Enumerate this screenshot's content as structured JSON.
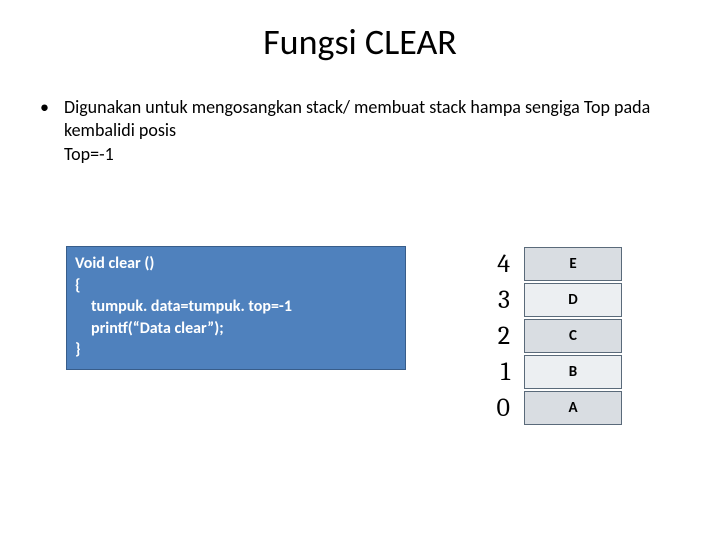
{
  "title": "Fungsi CLEAR",
  "bullet": {
    "marker": "•",
    "line1": "Digunakan untuk mengosangkan stack/ membuat stack hampa sengiga Top pada kembalidi posis",
    "line2": "Top=-1"
  },
  "code": {
    "l1": "Void clear ()",
    "l2": "{",
    "l3": "tumpuk. data=tumpuk. top=-1",
    "l4": "printf(“Data clear”);",
    "l5": "}"
  },
  "stack": [
    {
      "index": "4",
      "label": "E",
      "alt": false
    },
    {
      "index": "3",
      "label": "D",
      "alt": true
    },
    {
      "index": "2",
      "label": "C",
      "alt": false
    },
    {
      "index": "1",
      "label": "B",
      "alt": true
    },
    {
      "index": "0",
      "label": "A",
      "alt": false
    }
  ]
}
